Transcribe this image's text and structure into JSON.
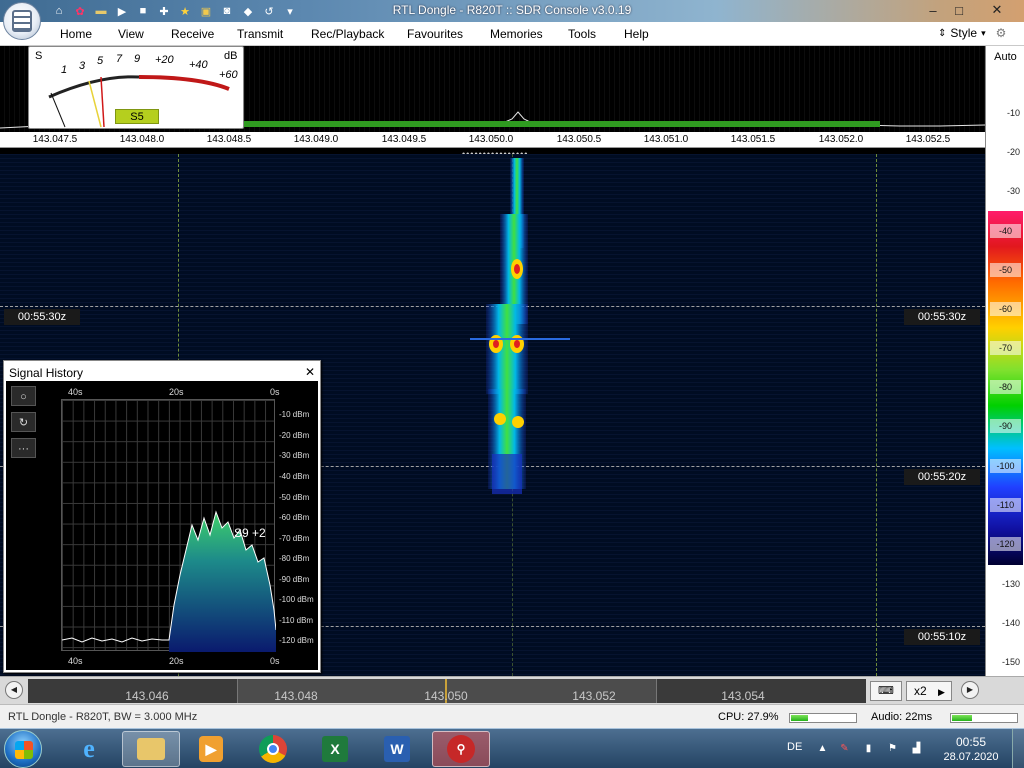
{
  "window": {
    "title": "RTL Dongle - R820T :: SDR Console v3.0.19",
    "quick_access": [
      "home-icon",
      "record-icon",
      "folder-icon",
      "play-icon",
      "stop-icon",
      "add-icon",
      "favourite-star-icon",
      "lock-icon",
      "camera-icon",
      "drop-icon",
      "undo-icon",
      "dropdown-icon"
    ],
    "controls": {
      "minimize": "–",
      "maximize": "□",
      "close": "✕"
    }
  },
  "menu": {
    "items": [
      "Home",
      "View",
      "Receive",
      "Transmit",
      "Rec/Playback",
      "Favourites",
      "Memories",
      "Tools",
      "Help"
    ],
    "style_label": "Style"
  },
  "meter": {
    "s_label": "S",
    "db_label": "dB",
    "scale_left": [
      "1",
      "3",
      "5",
      "7",
      "9"
    ],
    "scale_right": [
      "+20",
      "+40",
      "+60"
    ],
    "reading": "S5"
  },
  "frequency_axis": {
    "ticks": [
      "143.047.5",
      "143.048.0",
      "143.048.5",
      "143.049.0",
      "143.049.5",
      "143.050.0",
      "143.050.5",
      "143.051.0",
      "143.051.5",
      "143.052.0",
      "143.052.5"
    ]
  },
  "level_scale": {
    "auto_label": "Auto",
    "ticks": [
      "-10",
      "-20",
      "-30",
      "-130",
      "-140",
      "-150"
    ],
    "palette_labels": [
      "-40",
      "-50",
      "-60",
      "-70",
      "-80",
      "-90",
      "-100",
      "-110",
      "-120"
    ],
    "palette_colors": {
      "top": "#ff1b6b",
      "red": "#e2181e",
      "orange": "#ff6a00",
      "yellow": "#ffd000",
      "green": "#00d000",
      "cyan": "#00c0ff",
      "blue": "#2040ff",
      "bottom": "#000030"
    }
  },
  "waterfall": {
    "time_labels": [
      "00:55:30z",
      "00:55:20z",
      "00:55:10z"
    ]
  },
  "signal_history": {
    "title": "Signal History",
    "close": "✕",
    "tools": [
      "circle-icon",
      "refresh-icon",
      "more-icon"
    ],
    "x_top": [
      "40s",
      "20s",
      "0s"
    ],
    "x_bottom": [
      "40s",
      "20s",
      "0s"
    ],
    "y_labels": [
      "-10 dBm",
      "-20 dBm",
      "-30 dBm",
      "-40 dBm",
      "-50 dBm",
      "-60 dBm",
      "-70 dBm",
      "-80 dBm",
      "-90 dBm",
      "-100 dBm",
      "-110 dBm",
      "-120 dBm"
    ],
    "reading": "S9 +2"
  },
  "tuning": {
    "freqs": [
      "143.046",
      "143.048",
      "143.050",
      "143.052",
      "143.054"
    ],
    "zoom": "x2",
    "zoom_arrow": "▶",
    "keyboard_icon": "keyboard-icon"
  },
  "status": {
    "device": "RTL Dongle - R820T, BW = 3.000 MHz",
    "cpu": "CPU: 27.9%",
    "cpu_fraction": 0.26,
    "audio": "Audio: 22ms",
    "audio_fraction": 0.3
  },
  "taskbar": {
    "apps": [
      "internet-explorer-icon",
      "explorer-folder-icon",
      "media-player-icon",
      "chrome-icon",
      "excel-icon",
      "word-icon",
      "sdr-console-icon"
    ],
    "language": "DE",
    "time": "00:55",
    "date": "28.07.2020"
  }
}
